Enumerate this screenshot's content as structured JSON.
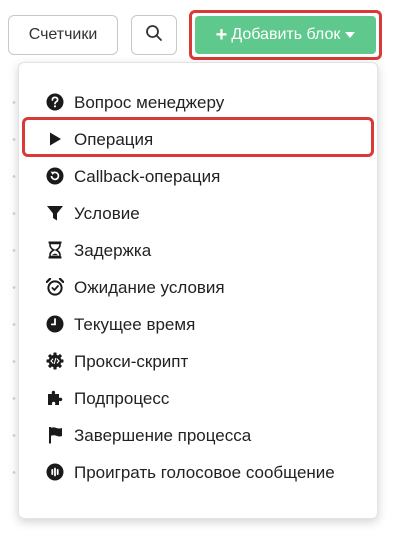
{
  "toolbar": {
    "counters_label": "Счетчики",
    "search_icon": "search-icon",
    "add_block_label": "Добавить блок",
    "add_icon": "plus-icon",
    "dropdown_icon": "caret-down-icon"
  },
  "colors": {
    "add_button_bg": "#5fc88c",
    "highlight_border": "#d93a36",
    "icon_color": "#1a1a1a"
  },
  "menu": {
    "items": [
      {
        "label": "Вопрос менеджеру",
        "icon": "question-circle-icon"
      },
      {
        "label": "Операция",
        "icon": "play-icon"
      },
      {
        "label": "Callback-операция",
        "icon": "callback-icon"
      },
      {
        "label": "Условие",
        "icon": "filter-icon"
      },
      {
        "label": "Задержка",
        "icon": "hourglass-icon"
      },
      {
        "label": "Ожидание условия",
        "icon": "alarm-clock-icon"
      },
      {
        "label": "Текущее время",
        "icon": "clock-icon"
      },
      {
        "label": "Прокси-скрипт",
        "icon": "code-gear-icon"
      },
      {
        "label": "Подпроцесс",
        "icon": "puzzle-icon"
      },
      {
        "label": "Завершение процесса",
        "icon": "flag-icon"
      },
      {
        "label": "Проиграть голосовое сообщение",
        "icon": "voice-message-icon"
      }
    ]
  }
}
